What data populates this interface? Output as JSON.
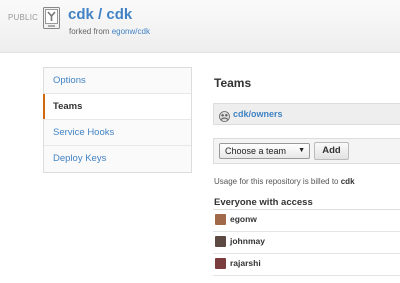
{
  "header": {
    "visibility": "PUBLIC",
    "owner": "cdk",
    "separator": "/",
    "repo": "cdk",
    "forked_prefix": "forked from",
    "forked_source": "egonw/cdk",
    "icon": "repo-fork-icon"
  },
  "sidebar": {
    "items": [
      {
        "label": "Options",
        "active": false
      },
      {
        "label": "Teams",
        "active": true
      },
      {
        "label": "Service Hooks",
        "active": false
      },
      {
        "label": "Deploy Keys",
        "active": false
      }
    ]
  },
  "main": {
    "title": "Teams",
    "team": {
      "name": "cdk/owners",
      "icon": "team-icon"
    },
    "add_team": {
      "select_value": "Choose a team",
      "button_label": "Add"
    },
    "billing_prefix": "Usage for this repository is billed to",
    "billing_owner": "cdk",
    "access_title": "Everyone with access",
    "members": [
      {
        "name": "egonw",
        "avatar_color": "#a06a4a"
      },
      {
        "name": "johnmay",
        "avatar_color": "#5c4a42"
      },
      {
        "name": "rajarshi",
        "avatar_color": "#7a3c3c"
      }
    ]
  },
  "colors": {
    "link": "#4183c4",
    "active_marker": "#d26911"
  }
}
